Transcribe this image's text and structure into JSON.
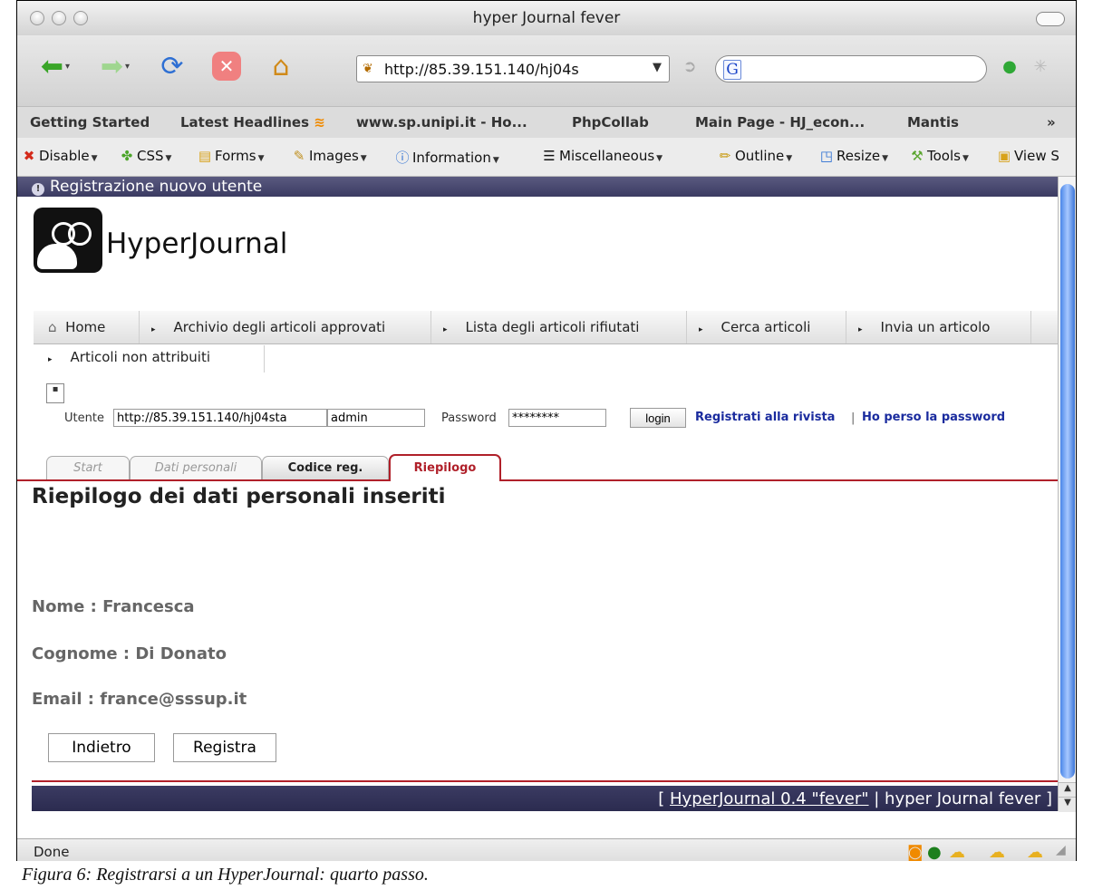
{
  "window": {
    "title": "hyper Journal fever"
  },
  "navbar": {
    "url": "http://85.39.151.140/hj04s",
    "search_value": ""
  },
  "bookmarks": [
    "Getting Started",
    "Latest Headlines",
    "www.sp.unipi.it - Ho...",
    "PhpCollab",
    "Main Page - HJ_econ...",
    "Mantis",
    "»"
  ],
  "devbar": [
    {
      "label": "Disable",
      "icon": "disable-icon"
    },
    {
      "label": "CSS",
      "icon": "css-icon"
    },
    {
      "label": "Forms",
      "icon": "forms-icon"
    },
    {
      "label": "Images",
      "icon": "images-icon"
    },
    {
      "label": "Information",
      "icon": "information-icon"
    },
    {
      "label": "Miscellaneous",
      "icon": "miscellaneous-icon"
    },
    {
      "label": "Outline",
      "icon": "outline-icon"
    },
    {
      "label": "Resize",
      "icon": "resize-icon"
    },
    {
      "label": "Tools",
      "icon": "tools-icon"
    },
    {
      "label": "View S",
      "icon": "view-source-icon"
    }
  ],
  "page": {
    "header": "Registrazione nuovo utente",
    "brand": "HyperJournal",
    "menu": [
      "Home",
      "Archivio degli articoli approvati",
      "Lista degli articoli rifiutati",
      "Cerca articoli",
      "Invia un articolo",
      "Articoli non attribuiti"
    ],
    "login": {
      "user_label": "Utente",
      "openid_value": "http://85.39.151.140/hj04sta",
      "username_value": "admin",
      "password_label": "Password",
      "password_value": "********",
      "login_button": "login",
      "register_link": "Registrati alla rivista",
      "separator": "|",
      "lost_password_link": "Ho perso la password"
    },
    "tabs": [
      "Start",
      "Dati personali",
      "Codice reg.",
      "Riepilogo"
    ],
    "heading": "Riepilogo dei dati personali inseriti",
    "fields": [
      "Nome : Francesca",
      "Cognome : Di Donato",
      "Email : france@sssup.it"
    ],
    "buttons": {
      "back": "Indietro",
      "register": "Registra"
    },
    "footer": {
      "open": "[",
      "link": "HyperJournal 0.4 \"fever\"",
      "rest": "| hyper Journal fever ]"
    }
  },
  "status": {
    "text": "Done"
  },
  "caption": "Figura 6: Registrarsi a un HyperJournal: quarto passo.",
  "colors": {
    "accent_red": "#b0202a",
    "header_navy": "#3b3b62",
    "link_blue": "#1a2b9e"
  }
}
